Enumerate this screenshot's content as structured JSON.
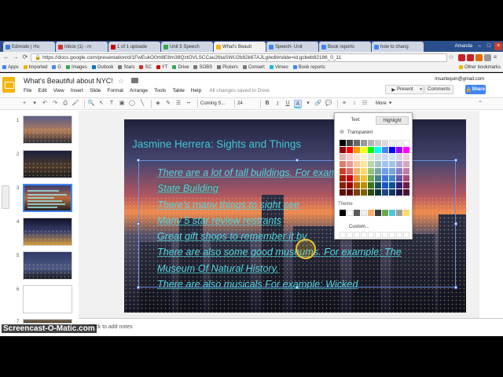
{
  "browser": {
    "tabs": [
      {
        "label": "Edmodo | Ho",
        "color": "#3c7bd5"
      },
      {
        "label": "Inbox (1) - m",
        "color": "#d93025"
      },
      {
        "label": "1 of 1 uploade",
        "color": "#cc0000"
      },
      {
        "label": "Unit 5 Speech",
        "color": "#34a853"
      },
      {
        "label": "What's Beauti",
        "color": "#f4b400"
      },
      {
        "label": "Speech- Unit",
        "color": "#4285f4"
      },
      {
        "label": "Book reports",
        "color": "#4285f4"
      },
      {
        "label": "how to chang",
        "color": "#4285f4"
      }
    ],
    "active_tab_index": 4,
    "window_user": "Amanda",
    "url": "https://docs.google.com/presentation/d/1FwEukO0m8E8m38QztOVLSCCau26taSWU2b82k67AJLg/edit#slide=id.gcbeb82186_0_11",
    "bookmarks": [
      {
        "label": "Apps",
        "color": "#4285f4"
      },
      {
        "label": "Imported",
        "color": "#f4b400"
      },
      {
        "label": "G",
        "color": "#4285f4"
      },
      {
        "label": "Images",
        "color": "#34a853"
      },
      {
        "label": "Outlook",
        "color": "#0072c6"
      },
      {
        "label": "Stars",
        "color": "#777777"
      },
      {
        "label": "SC",
        "color": "#d93025"
      },
      {
        "label": "YT",
        "color": "#cc0000"
      },
      {
        "label": "Drive",
        "color": "#34a853"
      },
      {
        "label": "SOBS",
        "color": "#777777"
      },
      {
        "label": "Pickers",
        "color": "#777777"
      },
      {
        "label": "Consert",
        "color": "#777777"
      },
      {
        "label": "Vimeo",
        "color": "#1ab7ea"
      },
      {
        "label": "Book reports",
        "color": "#4285f4"
      }
    ],
    "other_bookmarks": "Other bookmarks"
  },
  "app": {
    "doc_title": "What's Beautiful about NYC!",
    "menus": [
      "File",
      "Edit",
      "View",
      "Insert",
      "Slide",
      "Format",
      "Arrange",
      "Tools",
      "Table",
      "Help"
    ],
    "save_status": "All changes saved in Drive",
    "user_email": "msarlequin@gmail.com",
    "present_label": "Present",
    "comments_label": "Comments",
    "share_label": "Share",
    "toolbar": {
      "font": "Coming S...",
      "size": "24",
      "bold": "B",
      "italic": "I",
      "underline": "U",
      "more": "More"
    }
  },
  "filmstrip": {
    "numbers": [
      "1",
      "2",
      "3",
      "4",
      "5",
      "6",
      "7"
    ],
    "selected_index": 2
  },
  "slide": {
    "title": "Jasmine Herrera: Sights and Things",
    "bullets": [
      "There are a lot of tall buildings. For example: Empire",
      "State Building",
      "There's many things to sight see",
      "Many 5 star review restrants",
      "Great gift shops to remember it by",
      "There are also some good museums. For example: The",
      "Museum Of Natural History.",
      "There are also musicals For example: Wicked"
    ]
  },
  "color_popup": {
    "tab_text": "Text",
    "tab_highlight": "Highlight",
    "transparent_label": "Transparent",
    "theme_label": "Theme",
    "custom_label": "Custom...",
    "grid_rows": [
      [
        "#000000",
        "#434343",
        "#666666",
        "#999999",
        "#b7b7b7",
        "#cccccc",
        "#d9d9d9",
        "#efefef",
        "#f3f3f3",
        "#ffffff"
      ],
      [
        "#980000",
        "#ff0000",
        "#ff9900",
        "#ffff00",
        "#00ff00",
        "#00ffff",
        "#4a86e8",
        "#0000ff",
        "#9900ff",
        "#ff00ff"
      ],
      [
        "#e6b8af",
        "#f4cccc",
        "#fce5cd",
        "#fff2cc",
        "#d9ead3",
        "#d0e0e3",
        "#c9daf8",
        "#cfe2f3",
        "#d9d2e9",
        "#ead1dc"
      ],
      [
        "#dd7e6b",
        "#ea9999",
        "#f9cb9c",
        "#ffe599",
        "#b6d7a8",
        "#a2c4c9",
        "#a4c2f4",
        "#9fc5e8",
        "#b4a7d6",
        "#d5a6bd"
      ],
      [
        "#cc4125",
        "#e06666",
        "#f6b26b",
        "#ffd966",
        "#93c47d",
        "#76a5af",
        "#6d9eeb",
        "#6fa8dc",
        "#8e7cc3",
        "#c27ba0"
      ],
      [
        "#a61c00",
        "#cc0000",
        "#e69138",
        "#f1c232",
        "#6aa84f",
        "#45818e",
        "#3c78d8",
        "#3d85c6",
        "#674ea7",
        "#a64d79"
      ],
      [
        "#85200c",
        "#990000",
        "#b45f06",
        "#bf9000",
        "#38761d",
        "#134f5c",
        "#1155cc",
        "#0b5394",
        "#351c75",
        "#741b47"
      ],
      [
        "#5b0f00",
        "#660000",
        "#783f04",
        "#7f6000",
        "#274e13",
        "#0c343d",
        "#1c4587",
        "#073763",
        "#20124d",
        "#4c1130"
      ]
    ],
    "theme_row": [
      "#000000",
      "#ffffff",
      "#595959",
      "#eeeeee",
      "#f6b26b",
      "#3a3a3a",
      "#6aa84f",
      "#4fc7d9",
      "#9e9e9e",
      "#ffd966"
    ]
  },
  "notes": {
    "placeholder": "Click to add notes"
  },
  "watermark": "Screencast-O-Matic.com"
}
